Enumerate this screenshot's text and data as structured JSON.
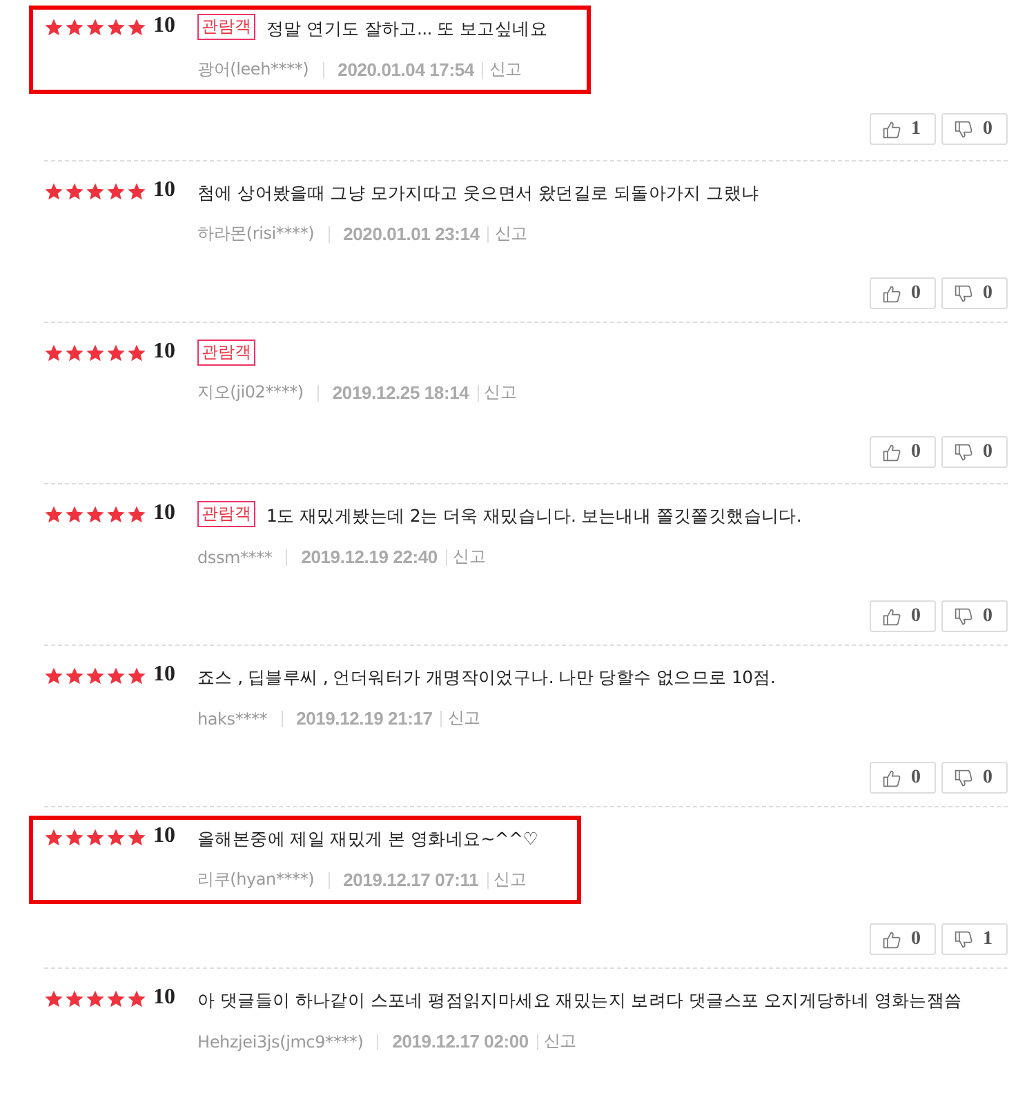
{
  "reviews": [
    {
      "stars": 5,
      "score": "10",
      "badge": "관람객",
      "text": "정말 연기도 잘하고... 또 보고싶네요",
      "author": "광어(leeh****)",
      "date": "2020.01.04 17:54",
      "report": "신고",
      "likes": "1",
      "dislikes": "0",
      "highlighted": true
    },
    {
      "stars": 5,
      "score": "10",
      "text": "첨에 상어봤을때 그냥 모가지따고 웃으면서 왔던길로 되돌아가지 그랬냐",
      "author": "하라몬(risi****)",
      "date": "2020.01.01 23:14",
      "report": "신고",
      "likes": "0",
      "dislikes": "0",
      "highlighted": false
    },
    {
      "stars": 5,
      "score": "10",
      "badge": "관람객",
      "author": "지오(ji02****)",
      "date": "2019.12.25 18:14",
      "report": "신고",
      "likes": "0",
      "dislikes": "0",
      "highlighted": false
    },
    {
      "stars": 5,
      "score": "10",
      "badge": "관람객",
      "text": "1도 재밌게봤는데 2는 더욱 재밌습니다. 보는내내 쫄깃쫄깃했습니다.",
      "author": "dssm****",
      "date": "2019.12.19 22:40",
      "report": "신고",
      "likes": "0",
      "dislikes": "0",
      "highlighted": false
    },
    {
      "stars": 5,
      "score": "10",
      "text": "죠스 , 딥블루씨 , 언더워터가 개명작이었구나. 나만 당할수 없으므로 10점.",
      "author": "haks****",
      "date": "2019.12.19 21:17",
      "report": "신고",
      "likes": "0",
      "dislikes": "0",
      "highlighted": false
    },
    {
      "stars": 5,
      "score": "10",
      "text": "올해본중에 제일 재밌게 본 영화네요~^^♡",
      "author": "리쿠(hyan****)",
      "date": "2019.12.17 07:11",
      "report": "신고",
      "likes": "0",
      "dislikes": "1",
      "highlighted": true
    },
    {
      "stars": 5,
      "score": "10",
      "text": "아 댓글들이 하나같이 스포네 평점읽지마세요 재밌는지 보려다 댓글스포 오지게당하네 영화는잼씀",
      "author": "Hehzjei3js(jmc9****)",
      "date": "2019.12.17 02:00",
      "report": "신고",
      "highlighted": false
    }
  ]
}
